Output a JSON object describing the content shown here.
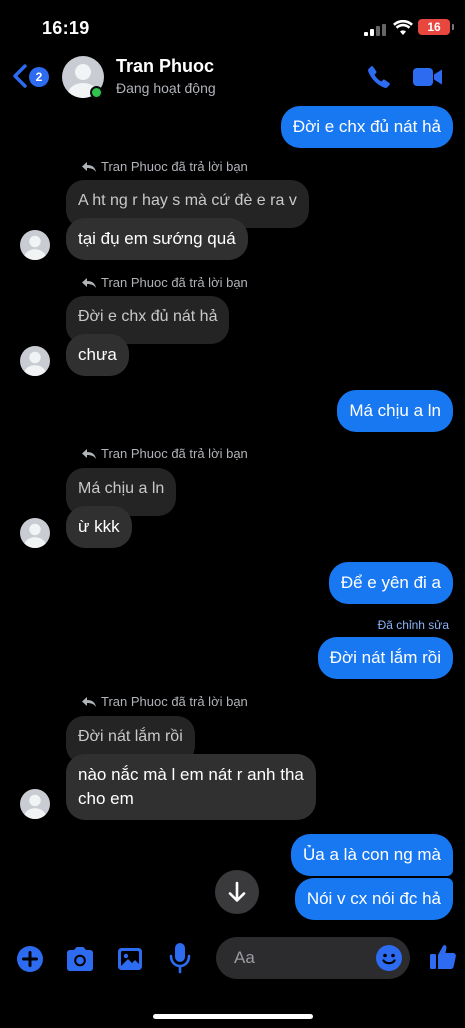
{
  "status_bar": {
    "time": "16:19",
    "battery": "16"
  },
  "header": {
    "back_count": "2",
    "contact_name": "Tran Phuoc",
    "contact_status": "Đang hoạt động"
  },
  "messages": {
    "m1": "Đời e chx đủ nát hả",
    "reply_label": "Tran Phuoc đã trả lời bạn",
    "g1_quote": "A ht ng r hay s mà cứ đè e ra v",
    "g1_msg": "tại đụ em sướng quá",
    "g2_quote": "Đời e chx đủ nát hả",
    "g2_msg": "chưa",
    "m2": "Má chịu a ln",
    "g3_quote": "Má chịu a ln",
    "g3_msg": "ừ kkk",
    "m3": "Để e yên đi a",
    "edited": "Đã chỉnh sửa",
    "m4": "Đời nát lắm rồi",
    "g4_quote": "Đời nát lắm rồi",
    "g4_msg_line1": "nào nắc mà l em nát r anh tha",
    "g4_msg_line2": "cho em",
    "m5": "Ủa a là con ng mà",
    "m6": "Nói v cx nói đc hả"
  },
  "composer": {
    "placeholder": "Aa"
  },
  "colors": {
    "accent": "#1778f2",
    "incoming": "#303030",
    "online": "#31c24d",
    "battery": "#e8473f"
  },
  "icons": [
    "back-chevron-icon",
    "phone-icon",
    "video-camera-icon",
    "reply-arrow-icon",
    "arrow-down-icon",
    "plus-icon",
    "camera-icon",
    "image-icon",
    "microphone-icon",
    "emoji-icon",
    "thumbs-up-icon"
  ]
}
